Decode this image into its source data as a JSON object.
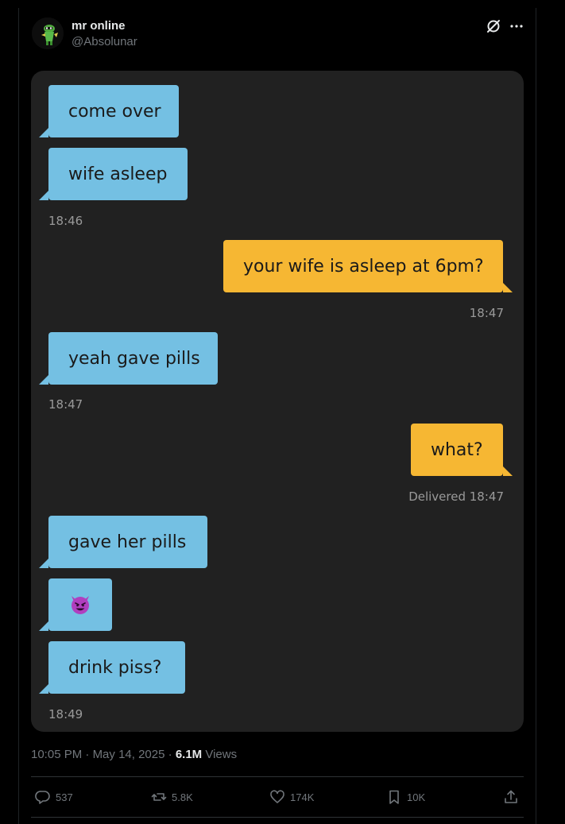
{
  "post": {
    "author_name": "mr online",
    "author_handle": "@Absolunar",
    "time": "10:05 PM",
    "date": "May 14, 2025",
    "separator": "·",
    "views_count": "6.1M",
    "views_label": "Views"
  },
  "chat": {
    "messages": [
      {
        "text": "come over",
        "side": "in"
      },
      {
        "text": "wife asleep",
        "side": "in"
      },
      {
        "text": "your wife is asleep at 6pm?",
        "side": "out"
      },
      {
        "text": "yeah gave pills",
        "side": "in"
      },
      {
        "text": "what?",
        "side": "out"
      },
      {
        "text": "gave her pills",
        "side": "in"
      },
      {
        "text": "",
        "side": "in",
        "icon": "smiling-devil-emoji"
      },
      {
        "text": "drink piss?",
        "side": "in"
      }
    ],
    "timestamps": [
      "18:46",
      "18:47",
      "18:47",
      "Delivered 18:47",
      "18:49"
    ],
    "colors": {
      "incoming_bubble": "#74c0e3",
      "outgoing_bubble": "#f6b733",
      "chat_background": "#212121"
    }
  },
  "actions": {
    "replies": "537",
    "reposts": "5.8K",
    "likes": "174K",
    "bookmarks": "10K"
  },
  "icons": [
    "grok-icon",
    "more-icon",
    "reply-icon",
    "repost-icon",
    "like-icon",
    "bookmark-icon",
    "share-icon"
  ]
}
